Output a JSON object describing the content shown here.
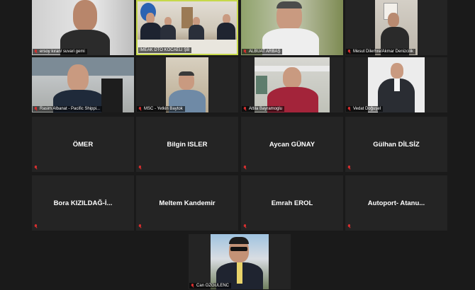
{
  "participants": [
    {
      "id": "p1",
      "label": "ersoy kıran/ suvari gemi",
      "video": true
    },
    {
      "id": "p2",
      "label": "İMEAK DTO KOCAELİ ŞB",
      "video": true,
      "active": true
    },
    {
      "id": "p3",
      "label": "ALBÜAT ARBAŞ",
      "video": true
    },
    {
      "id": "p4",
      "label": "Mesut Dilerhre/Akmar Denizcilik",
      "video": true
    },
    {
      "id": "p5",
      "label": "Rasim Albanat - Pacific Shippi...",
      "video": true
    },
    {
      "id": "p6",
      "label": "MSC - Yetkin Baytok",
      "video": true
    },
    {
      "id": "p7",
      "label": "Attila Bayramoglu",
      "video": true
    },
    {
      "id": "p8",
      "label": "Vedat Doğuşel",
      "video": true
    },
    {
      "id": "p9",
      "name": "ÖMER",
      "video": false
    },
    {
      "id": "p10",
      "name": "Bilgin ISLER",
      "video": false
    },
    {
      "id": "p11",
      "name": "Aycan GÜNAY",
      "video": false
    },
    {
      "id": "p12",
      "name": "Gülhan DİLSİZ",
      "video": false
    },
    {
      "id": "p13",
      "name": "Bora  KIZILDAĞ-İ...",
      "video": false
    },
    {
      "id": "p14",
      "name": "Meltem Kandemir",
      "video": false
    },
    {
      "id": "p15",
      "name": "Emrah EROL",
      "video": false
    },
    {
      "id": "p16",
      "name": "Autoport-  Atanu...",
      "video": false
    },
    {
      "id": "p17",
      "label": "Can OZGULENC",
      "video": true
    }
  ],
  "colors": {
    "background": "#1a1a1a",
    "tile": "#242424",
    "active_border": "#c6d84a",
    "mic_muted": "#d62f2f"
  },
  "icons": {
    "mic": "mic-muted-icon"
  }
}
